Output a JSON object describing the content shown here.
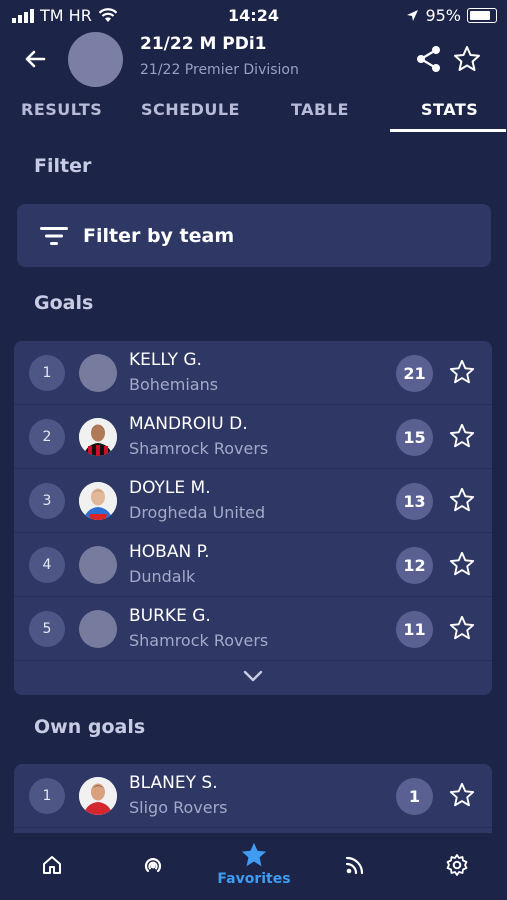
{
  "status_bar": {
    "carrier": "TM HR",
    "time": "14:24",
    "battery": "95%",
    "battery_level": 0.95
  },
  "header": {
    "title": "21/22 M PDi1",
    "subtitle": "21/22 Premier Division"
  },
  "tabs": [
    {
      "label": "RESULTS"
    },
    {
      "label": "SCHEDULE"
    },
    {
      "label": "TABLE"
    },
    {
      "label": "STATS",
      "active": true
    }
  ],
  "filter": {
    "section_label": "Filter",
    "button_label": "Filter by team"
  },
  "goals": {
    "section_label": "Goals",
    "rows": [
      {
        "rank": "1",
        "name": "KELLY G.",
        "team": "Bohemians",
        "count": "21",
        "avatar": "placeholder"
      },
      {
        "rank": "2",
        "name": "MANDROIU D.",
        "team": "Shamrock Rovers",
        "count": "15",
        "avatar": "photo"
      },
      {
        "rank": "3",
        "name": "DOYLE M.",
        "team": "Drogheda United",
        "count": "13",
        "avatar": "photo"
      },
      {
        "rank": "4",
        "name": "HOBAN P.",
        "team": "Dundalk",
        "count": "12",
        "avatar": "placeholder"
      },
      {
        "rank": "5",
        "name": "BURKE G.",
        "team": "Shamrock Rovers",
        "count": "11",
        "avatar": "placeholder"
      }
    ]
  },
  "own_goals": {
    "section_label": "Own goals",
    "rows": [
      {
        "rank": "1",
        "name": "BLANEY S.",
        "team": "Sligo Rovers",
        "count": "1",
        "avatar": "photo"
      }
    ]
  },
  "bottom_nav": {
    "items": [
      {
        "icon": "home-icon"
      },
      {
        "icon": "live-icon"
      },
      {
        "icon": "star-icon",
        "label": "Favorites",
        "active": true
      },
      {
        "icon": "feed-icon"
      },
      {
        "icon": "settings-icon"
      }
    ]
  },
  "colors": {
    "background": "#1c2447",
    "card": "#2f3764",
    "accent": "#3f9cf2"
  }
}
